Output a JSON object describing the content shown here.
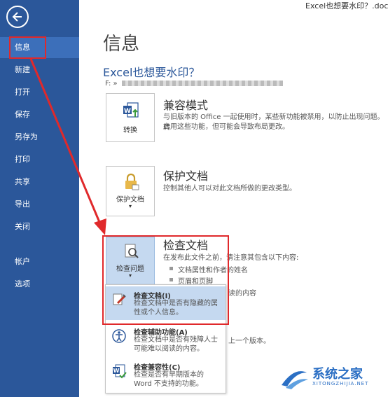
{
  "window": {
    "title": "Excel也想要水印？.docx ["
  },
  "sidebar": {
    "items": [
      {
        "label": "信息",
        "active": true
      },
      {
        "label": "新建"
      },
      {
        "label": "打开"
      },
      {
        "label": "保存"
      },
      {
        "label": "另存为"
      },
      {
        "label": "打印"
      },
      {
        "label": "共享"
      },
      {
        "label": "导出"
      },
      {
        "label": "关闭"
      },
      {
        "label": "帐户"
      },
      {
        "label": "选项"
      }
    ]
  },
  "main": {
    "heading": "信息",
    "doc_title": "Excel也想要水印？",
    "path_prefix": "F: »",
    "compat": {
      "button_label": "转换",
      "title": "兼容模式",
      "desc_line1": "与旧版本的 Office 一起使用时，某些新功能被禁用，以防止出现问题。转",
      "desc_line2": "启用这些功能，但可能会导致布局更改。"
    },
    "protect": {
      "button_label": "保护文档",
      "title": "保护文档",
      "desc": "控制其他人可以对此文档所做的更改类型。"
    },
    "inspect": {
      "button_label": "检查问题",
      "title": "检查文档",
      "desc": "在发布此文件之前，请注意其包含以下内容:",
      "bullets": [
        "文档属性和作者的姓名",
        "页眉和页脚"
      ],
      "cont1": "读的内容",
      "cont2": "上一个版本。"
    }
  },
  "dropdown": {
    "items": [
      {
        "title": "检查文档(I)",
        "desc": "检查文档中是否有隐藏的属性或个人信息。"
      },
      {
        "title": "检查辅助功能(A)",
        "desc": "检查文档中是否有残障人士可能难以阅读的内容。"
      },
      {
        "title": "检查兼容性(C)",
        "desc": "检查是否有早期版本的 Word 不支持的功能。"
      }
    ]
  },
  "watermark": {
    "text": "系统之家",
    "sub": "XITONGZHIJIA.NET"
  },
  "colors": {
    "sidebar": "#2b579a",
    "active": "#3c6fba",
    "annotation": "#e0292b",
    "menu_highlight": "#c5d9f0"
  }
}
